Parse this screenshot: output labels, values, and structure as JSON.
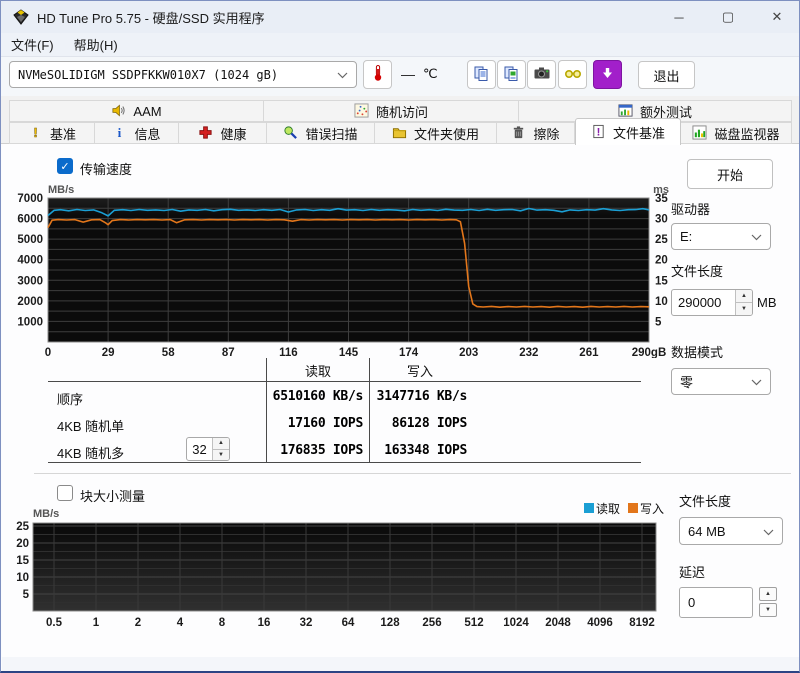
{
  "window": {
    "title": "HD Tune Pro 5.75 - 硬盘/SSD 实用程序",
    "controls": {
      "minimize": "─",
      "maximize": "▢",
      "close": "✕"
    }
  },
  "menu": {
    "items": [
      "文件(F)",
      "帮助(H)"
    ]
  },
  "toolbar": {
    "drive": "NVMeSOLIDIGM SSDPFKKW010X7 (1024 gB)",
    "temperature": "—",
    "temp_unit": "℃",
    "exit": "退出"
  },
  "tabs": {
    "top": [
      {
        "label": "AAM",
        "icon": "speaker-icon"
      },
      {
        "label": "随机访问",
        "icon": "scatter-icon"
      },
      {
        "label": "额外测试",
        "icon": "extra-tests-icon"
      }
    ],
    "bottom": [
      {
        "label": "基准",
        "icon": "exclamation-icon"
      },
      {
        "label": "信息",
        "icon": "info-icon"
      },
      {
        "label": "健康",
        "icon": "health-cross-icon"
      },
      {
        "label": "错误扫描",
        "icon": "magnifier-icon"
      },
      {
        "label": "文件夹使用",
        "icon": "folder-icon"
      },
      {
        "label": "擦除",
        "icon": "trash-icon"
      },
      {
        "label": "文件基准",
        "icon": "file-benchmark-icon",
        "active": true
      },
      {
        "label": "磁盘监视器",
        "icon": "disk-monitor-icon"
      }
    ],
    "active": "文件基准"
  },
  "file_benchmark": {
    "transfer_label": "传输速度",
    "transfer_checked": true,
    "start": "开始",
    "drive_label": "驱动器",
    "drive_value": "E:",
    "len_label": "文件长度",
    "len_value": "290000",
    "len_unit": "MB",
    "mode_label": "数据模式",
    "mode_value": "零",
    "queue_depth": "32",
    "table": {
      "col_read": "读取",
      "col_write": "写入",
      "rows": [
        {
          "label": "顺序",
          "read": "6510160 KB/s",
          "write": "3147716 KB/s"
        },
        {
          "label": "4KB 随机单",
          "read": "17160 IOPS",
          "write": "86128 IOPS"
        },
        {
          "label": "4KB 随机多",
          "read": "176835 IOPS",
          "write": "163348 IOPS"
        }
      ]
    }
  },
  "block_test": {
    "checkbox_label": "块大小测量",
    "checked": false,
    "legend_read": "读取",
    "legend_write": "写入",
    "len_label": "文件长度",
    "len_value": "64 MB",
    "delay_label": "延迟",
    "delay_value": "0"
  },
  "colors": {
    "read": "#1b9fd4",
    "write": "#e2761b",
    "accent": "#0b6bcb"
  },
  "icons": {
    "spin_up": "▲",
    "spin_down": "▼",
    "check": "✓"
  },
  "chart_data": [
    {
      "type": "line",
      "title": "传输速度",
      "xlim": [
        0,
        290
      ],
      "xticks": [
        0,
        29,
        58,
        87,
        116,
        145,
        174,
        203,
        232,
        261,
        290
      ],
      "xtick_labels": [
        "0",
        "29",
        "58",
        "87",
        "116",
        "145",
        "174",
        "203",
        "232",
        "261",
        "290gB"
      ],
      "ylabel_left": "MB/s",
      "ylim_left": [
        0,
        7000
      ],
      "yticks_left": [
        1000,
        2000,
        3000,
        4000,
        5000,
        6000,
        7000
      ],
      "ylabel_right": "ms",
      "ylim_right": [
        0,
        35
      ],
      "yticks_right": [
        5,
        10,
        15,
        20,
        25,
        30,
        35
      ],
      "grid": true,
      "series": [
        {
          "name": "读取",
          "color": "#1b9fd4",
          "points": [
            [
              0,
              6150
            ],
            [
              3,
              6400
            ],
            [
              6,
              6430
            ],
            [
              10,
              6380
            ],
            [
              14,
              6440
            ],
            [
              18,
              6390
            ],
            [
              22,
              6420
            ],
            [
              26,
              6280
            ],
            [
              29,
              6130
            ],
            [
              32,
              6400
            ],
            [
              36,
              6430
            ],
            [
              40,
              6390
            ],
            [
              44,
              6440
            ],
            [
              48,
              6400
            ],
            [
              52,
              6420
            ],
            [
              56,
              6390
            ],
            [
              60,
              6440
            ],
            [
              64,
              6360
            ],
            [
              68,
              6420
            ],
            [
              72,
              6400
            ],
            [
              76,
              6440
            ],
            [
              80,
              6380
            ],
            [
              84,
              6430
            ],
            [
              88,
              6450
            ],
            [
              92,
              6400
            ],
            [
              96,
              6420
            ],
            [
              100,
              6390
            ],
            [
              104,
              6430
            ],
            [
              108,
              6400
            ],
            [
              112,
              6440
            ],
            [
              116,
              6320
            ],
            [
              120,
              6420
            ],
            [
              124,
              6440
            ],
            [
              128,
              6390
            ],
            [
              132,
              6430
            ],
            [
              136,
              6400
            ],
            [
              140,
              6480
            ],
            [
              144,
              6410
            ],
            [
              148,
              6430
            ],
            [
              152,
              6390
            ],
            [
              156,
              6440
            ],
            [
              160,
              6400
            ],
            [
              164,
              6430
            ],
            [
              168,
              6410
            ],
            [
              172,
              6380
            ],
            [
              176,
              6440
            ],
            [
              180,
              6400
            ],
            [
              184,
              6430
            ],
            [
              188,
              6390
            ],
            [
              192,
              6450
            ],
            [
              196,
              6410
            ],
            [
              200,
              6400
            ],
            [
              204,
              6440
            ],
            [
              208,
              6390
            ],
            [
              212,
              6450
            ],
            [
              216,
              6400
            ],
            [
              220,
              6430
            ],
            [
              224,
              6440
            ],
            [
              228,
              6380
            ],
            [
              232,
              6490
            ],
            [
              236,
              6410
            ],
            [
              240,
              6430
            ],
            [
              244,
              6400
            ],
            [
              248,
              6330
            ],
            [
              252,
              6420
            ],
            [
              256,
              6390
            ],
            [
              260,
              6430
            ],
            [
              264,
              6410
            ],
            [
              268,
              6480
            ],
            [
              272,
              6420
            ],
            [
              276,
              6390
            ],
            [
              280,
              6430
            ],
            [
              284,
              6440
            ],
            [
              287,
              6480
            ],
            [
              290,
              6420
            ]
          ]
        },
        {
          "name": "写入",
          "color": "#e2761b",
          "points": [
            [
              0,
              5560
            ],
            [
              2,
              5920
            ],
            [
              5,
              5950
            ],
            [
              9,
              5930
            ],
            [
              13,
              5950
            ],
            [
              17,
              5830
            ],
            [
              21,
              5940
            ],
            [
              25,
              5950
            ],
            [
              28,
              5780
            ],
            [
              29,
              5700
            ],
            [
              31,
              5900
            ],
            [
              35,
              5950
            ],
            [
              39,
              5930
            ],
            [
              43,
              5950
            ],
            [
              47,
              5940
            ],
            [
              51,
              5950
            ],
            [
              55,
              5930
            ],
            [
              59,
              5950
            ],
            [
              62,
              5800
            ],
            [
              66,
              5940
            ],
            [
              70,
              5950
            ],
            [
              74,
              5930
            ],
            [
              78,
              5950
            ],
            [
              82,
              5940
            ],
            [
              86,
              5950
            ],
            [
              90,
              5930
            ],
            [
              94,
              5950
            ],
            [
              98,
              5940
            ],
            [
              102,
              5950
            ],
            [
              106,
              5930
            ],
            [
              110,
              5950
            ],
            [
              114,
              5940
            ],
            [
              118,
              5870
            ],
            [
              122,
              5950
            ],
            [
              126,
              5930
            ],
            [
              130,
              5950
            ],
            [
              134,
              5940
            ],
            [
              138,
              5950
            ],
            [
              142,
              5930
            ],
            [
              146,
              5950
            ],
            [
              150,
              5940
            ],
            [
              154,
              5950
            ],
            [
              158,
              5930
            ],
            [
              162,
              5950
            ],
            [
              166,
              5940
            ],
            [
              170,
              5950
            ],
            [
              174,
              5930
            ],
            [
              178,
              5950
            ],
            [
              182,
              5940
            ],
            [
              186,
              5950
            ],
            [
              190,
              5930
            ],
            [
              194,
              5950
            ],
            [
              197,
              5940
            ],
            [
              199,
              5850
            ],
            [
              201,
              4800
            ],
            [
              203,
              2700
            ],
            [
              205,
              1850
            ],
            [
              207,
              1720
            ],
            [
              210,
              1700
            ],
            [
              214,
              1730
            ],
            [
              218,
              1690
            ],
            [
              222,
              1720
            ],
            [
              226,
              1700
            ],
            [
              230,
              1730
            ],
            [
              234,
              1700
            ],
            [
              238,
              1720
            ],
            [
              242,
              1690
            ],
            [
              246,
              1730
            ],
            [
              250,
              1700
            ],
            [
              254,
              1720
            ],
            [
              258,
              1690
            ],
            [
              262,
              1730
            ],
            [
              266,
              1700
            ],
            [
              270,
              1720
            ],
            [
              274,
              1700
            ],
            [
              278,
              1730
            ],
            [
              282,
              1700
            ],
            [
              286,
              1720
            ],
            [
              290,
              1710
            ]
          ]
        }
      ]
    },
    {
      "type": "line",
      "title": "块大小测量",
      "ylabel": "MB/s",
      "ylim": [
        0,
        25
      ],
      "yticks": [
        5,
        10,
        15,
        20,
        25
      ],
      "xtick_labels": [
        "0.5",
        "1",
        "2",
        "4",
        "8",
        "16",
        "32",
        "64",
        "128",
        "256",
        "512",
        "1024",
        "2048",
        "4096",
        "8192"
      ],
      "grid": true,
      "legend": [
        "读取",
        "写入"
      ],
      "series": []
    }
  ]
}
